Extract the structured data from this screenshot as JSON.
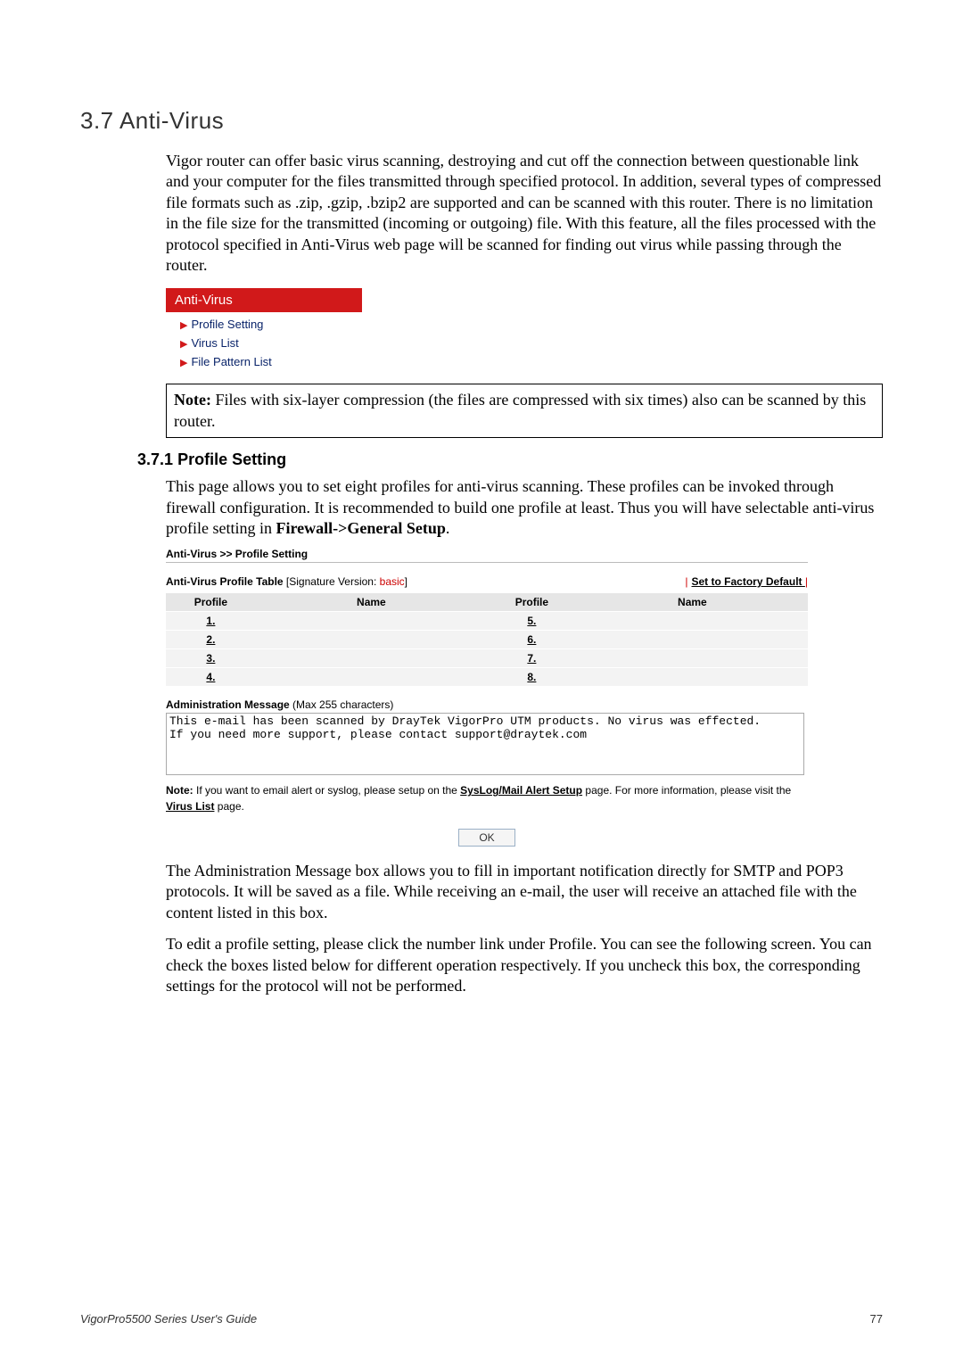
{
  "section": {
    "number": "3.7",
    "title": "Anti-Virus"
  },
  "intro_para": "Vigor router can offer basic virus scanning, destroying and cut off the connection between questionable link and your computer for the files transmitted through specified protocol. In addition, several types of compressed file formats such as .zip, .gzip, .bzip2 are supported and can be scanned with this router. There is no limitation in the file size for the transmitted (incoming or outgoing) file. With this feature, all the files processed with the protocol specified in Anti-Virus web page will be scanned for finding out virus while passing through the router.",
  "nav": {
    "header": "Anti-Virus",
    "items": [
      "Profile Setting",
      "Virus List",
      "File Pattern List"
    ]
  },
  "note_label": "Note:",
  "note_text": " Files with six-layer compression (the files are compressed with six times) also can be scanned by this router.",
  "subsection": {
    "number": "3.7.1",
    "title": "Profile Setting"
  },
  "profile_intro": {
    "pre": "This page allows you to set eight profiles for anti-virus scanning. These profiles can be invoked through firewall configuration. It is recommended to build one profile at least. Thus you will have selectable anti-virus profile setting in ",
    "bold": "Firewall->General Setup",
    "post": "."
  },
  "screenshot": {
    "breadcrumb": "Anti-Virus >> Profile Setting",
    "table_title_prefix": "Anti-Virus Profile Table",
    "table_title_sig_label": " [Signature Version: ",
    "table_title_sig_value": "basic",
    "table_title_sig_suffix": "]",
    "reset_link": "Set to Factory Default",
    "columns": [
      "Profile",
      "Name",
      "Profile",
      "Name"
    ],
    "rows_left": [
      "1.",
      "2.",
      "3.",
      "4."
    ],
    "rows_right": [
      "5.",
      "6.",
      "7.",
      "8."
    ],
    "admin_label_bold": "Administration Message",
    "admin_label_rest": " (Max 255 characters)",
    "admin_textarea_value": "This e-mail has been scanned by DrayTek VigorPro UTM products. No virus was effected.\nIf you need more support, please contact support@draytek.com",
    "note_prefix": "Note:",
    "note_body_1": " If you want to email alert or syslog, please setup on the ",
    "note_link_1": "SysLog/Mail Alert Setup",
    "note_body_2": " page.  For more information, please visit the ",
    "note_link_2": "Virus List",
    "note_body_3": " page.",
    "ok_button": "OK"
  },
  "closing_para_1": "The Administration Message box allows you to fill in important notification directly for SMTP and POP3 protocols. It will be saved as a file. While receiving an e-mail, the user will receive an attached file with the content listed in this box.",
  "closing_para_2": "To edit a profile setting, please click the number link under Profile. You can see the following screen. You can check the boxes listed below for different operation respectively. If you uncheck this box, the corresponding settings for the protocol will not be performed.",
  "footer": {
    "text": "VigorPro5500 Series User's Guide",
    "page": "77"
  }
}
